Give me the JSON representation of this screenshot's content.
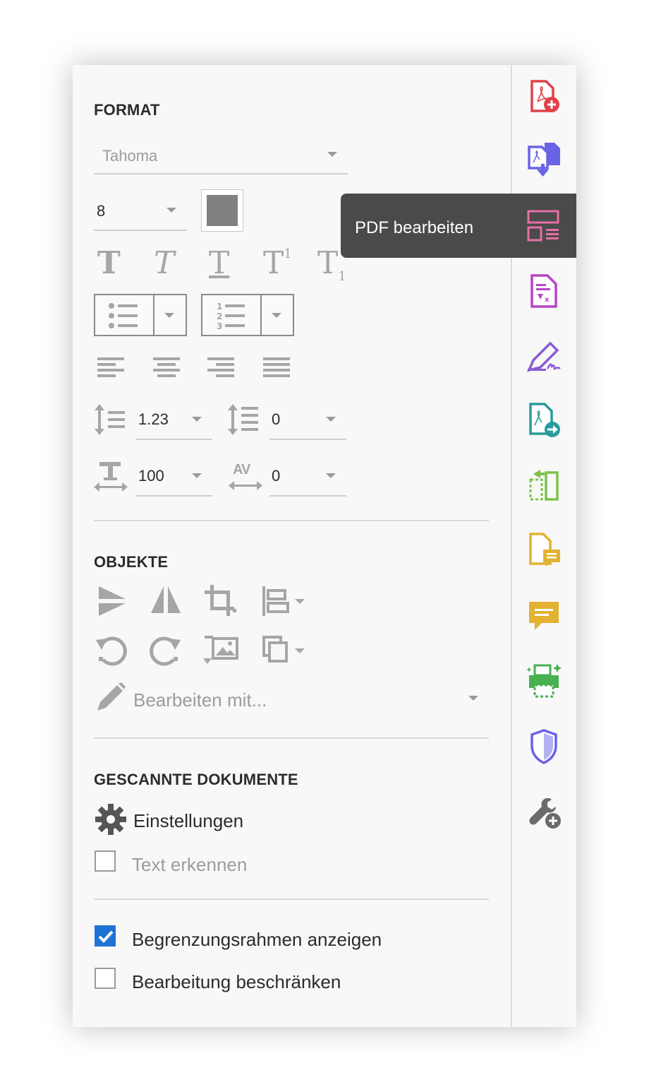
{
  "format": {
    "heading": "FORMAT",
    "font_family": "Tahoma",
    "font_size": "8",
    "text_styles": [
      "T",
      "T",
      "T",
      "T",
      "T"
    ],
    "superscript_mark": "1",
    "subscript_mark": "1",
    "line_spacing": "1.23",
    "paragraph_spacing": "0",
    "horizontal_scale": "100",
    "char_spacing": "0",
    "char_spacing_glyph": "AV",
    "color": "#808080"
  },
  "objects": {
    "heading": "OBJEKTE",
    "edit_with": "Bearbeiten mit..."
  },
  "scanned": {
    "heading": "GESCANNTE DOKUMENTE",
    "settings": "Einstellungen",
    "recognize_text": "Text erkennen"
  },
  "options": {
    "show_bounding_boxes": "Begrenzungsrahmen anzeigen",
    "show_bounding_boxes_checked": true,
    "restrict_editing": "Bearbeitung beschränken",
    "restrict_editing_checked": false
  },
  "tooltip": {
    "label": "PDF bearbeiten"
  },
  "tools": [
    {
      "name": "create-pdf",
      "color": "#e0414a"
    },
    {
      "name": "combine-files",
      "color": "#6a63e6"
    },
    {
      "name": "edit-pdf",
      "color": "#e86fa6"
    },
    {
      "name": "prepare-form",
      "color": "#b843c6"
    },
    {
      "name": "fill-sign",
      "color": "#8a5bd6"
    },
    {
      "name": "export-pdf",
      "color": "#2a9b9b"
    },
    {
      "name": "organize-pages",
      "color": "#7cc24a"
    },
    {
      "name": "send-for-comments",
      "color": "#e2b230"
    },
    {
      "name": "comment",
      "color": "#e2b230"
    },
    {
      "name": "print-production",
      "color": "#47b04f"
    },
    {
      "name": "protect",
      "color": "#6a63e6"
    },
    {
      "name": "more-tools",
      "color": "#6b6b6b"
    }
  ]
}
